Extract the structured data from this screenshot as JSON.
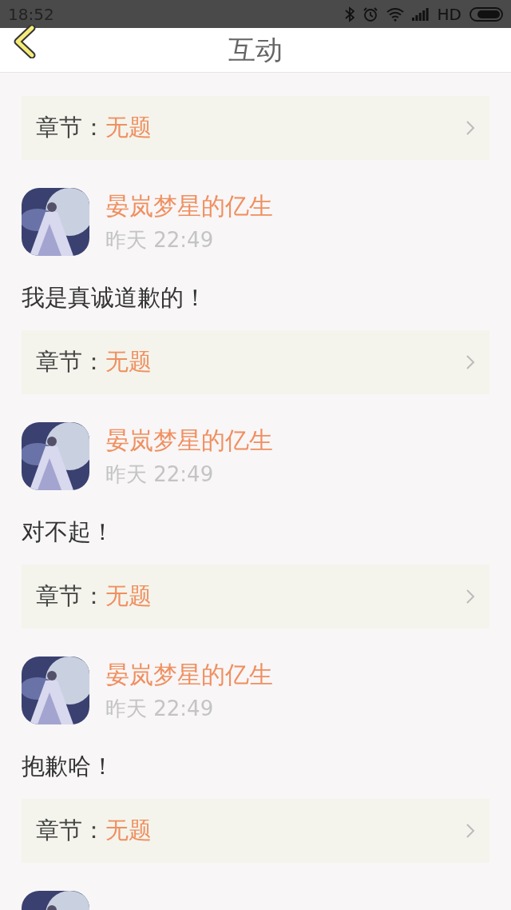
{
  "status_bar": {
    "time": "18:52",
    "network": "HD"
  },
  "header": {
    "title": "互动"
  },
  "comments": [
    {
      "chapter": {
        "label": "章节：",
        "value": "无题"
      }
    },
    {
      "name": "晏岚梦星的亿生",
      "time": "昨天 22:49",
      "text": "我是真诚道歉的！",
      "chapter": {
        "label": "章节：",
        "value": "无题"
      }
    },
    {
      "name": "晏岚梦星的亿生",
      "time": "昨天 22:49",
      "text": "对不起！",
      "chapter": {
        "label": "章节：",
        "value": "无题"
      }
    },
    {
      "name": "晏岚梦星的亿生",
      "time": "昨天 22:49",
      "text": "抱歉哈！",
      "chapter": {
        "label": "章节：",
        "value": "无题"
      }
    },
    {
      "kind": "picture"
    }
  ]
}
